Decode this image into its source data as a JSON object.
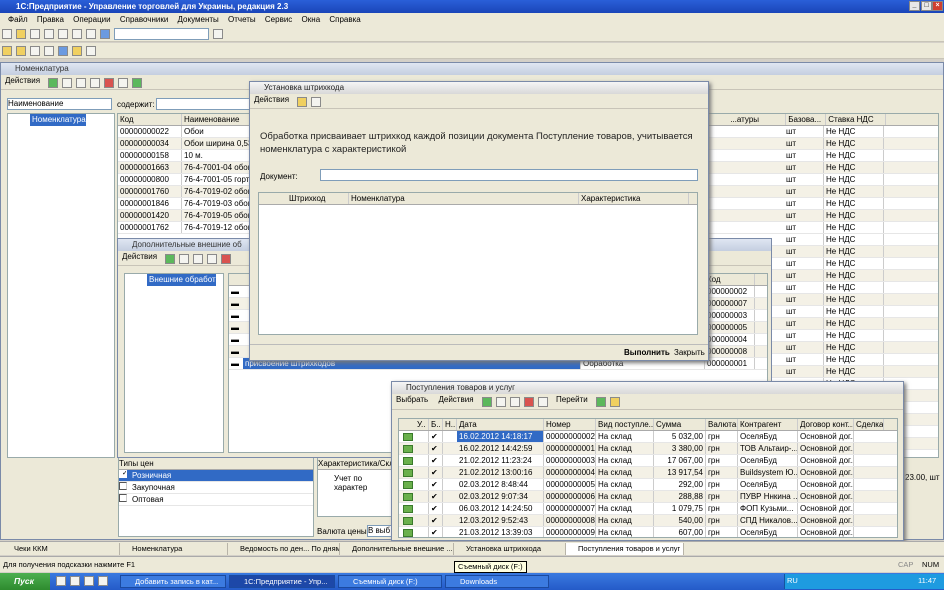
{
  "app": {
    "title": "1С:Предприятие - Управление торговлей для Украины, редакция 2.3"
  },
  "menu": [
    "Файл",
    "Правка",
    "Операции",
    "Справочники",
    "Документы",
    "Отчеты",
    "Сервис",
    "Окна",
    "Справка"
  ],
  "nomenclature": {
    "title": "Номенклатура",
    "actions": "Действия",
    "filter_field": "Наименование",
    "contains_label": "содержит:",
    "tree_root": "Номенклатура",
    "columns": [
      "Код",
      "Наименование"
    ],
    "right_columns": [
      "...атуры",
      "Базова...",
      "Ставка НДС"
    ],
    "rows": [
      [
        "00000000022",
        "Обои"
      ],
      [
        "00000000034",
        "Обои ширина 0,53 м"
      ],
      [
        "00000000158",
        "10 м."
      ],
      [
        "00000001663",
        "76-4-7001-04 обои о"
      ],
      [
        "00000000800",
        "76-4-7001-05 гортен"
      ],
      [
        "00000001760",
        "76-4-7019-02 обои а"
      ],
      [
        "00000001846",
        "76-4-7019-03 обои 5"
      ],
      [
        "00000001420",
        "76-4-7019-05 обои а"
      ],
      [
        "00000001762",
        "76-4-7019-12 обои а"
      ]
    ],
    "unit": "шт",
    "vat": "Не НДС",
    "price_types_header": "Типы цен",
    "price_types": [
      "Розничная",
      "Закупочная",
      "Оптовая"
    ],
    "char_header": "Характеристика/Скл",
    "char_value": "Учет по характер",
    "currency_label": "Валюта цены:",
    "currency_value": "В выб",
    "right_price": "23.00, шт"
  },
  "external": {
    "title": "Дополнительные внешние об",
    "actions": "Действия",
    "tree_root": "Внешние обработ",
    "code_header": "Код",
    "codes": [
      "000000002",
      "000000007",
      "000000003",
      "000000005",
      "000000004",
      "000000008",
      "000000001"
    ],
    "bottom_name": "присвоение штрихкодов",
    "bottom_type": "Обработка"
  },
  "barcode": {
    "title": "Установка штрихкода",
    "actions": "Действия",
    "message": "Обработка присваивает штрихкод каждой позиции документа  Поступление товаров, учитывается номенклатура с характеристикой",
    "doc_label": "Документ:",
    "columns": [
      "Штрихкод",
      "Номенклатура",
      "Характеристика"
    ],
    "run_button": "Выполнить",
    "close_button": "Закрыть"
  },
  "receipts": {
    "title": "Поступления товаров и услуг",
    "select_button": "Выбрать",
    "actions": "Действия",
    "goto": "Перейти",
    "columns": [
      "У..",
      "Б..",
      "Н..",
      "Дата",
      "Номер",
      "Вид поступле...",
      "Сумма",
      "Валюта",
      "Контрагент",
      "Договор конт...",
      "Сделка"
    ],
    "rows": [
      [
        "16.02.2012 14:18:17",
        "00000000002",
        "На склад",
        "5 032,00",
        "грн",
        "ОселяБуд",
        "Основной дог..."
      ],
      [
        "16.02.2012 14:42:59",
        "00000000001",
        "На склад",
        "3 380,00",
        "грн",
        "ТОВ Альтаир-...",
        "Основной дог..."
      ],
      [
        "21.02.2012 11:23:24",
        "00000000003",
        "На склад",
        "17 067,00",
        "грн",
        "ОселяБуд",
        "Основной дог..."
      ],
      [
        "21.02.2012 13:00:16",
        "00000000004",
        "На склад",
        "13 917,54",
        "грн",
        "Buildsystem Ю...",
        "Основной дог..."
      ],
      [
        "02.03.2012 8:48:44",
        "00000000005",
        "На склад",
        "292,00",
        "грн",
        "ОселяБуд",
        "Основной дог..."
      ],
      [
        "02.03.2012 9:07:34",
        "00000000006",
        "На склад",
        "288,88",
        "грн",
        "ПУВР Ннкина ...",
        "Основной дог..."
      ],
      [
        "06.03.2012 14:24:50",
        "00000000007",
        "На склад",
        "1 079,75",
        "грн",
        "ФОП Кузьми...",
        "Основной дог..."
      ],
      [
        "12.03.2012 9:52:43",
        "00000000008",
        "На склад",
        "540,00",
        "грн",
        "СПД Никалов...",
        "Основной дог..."
      ],
      [
        "21.03.2012 13:39:03",
        "00000000009",
        "На склад",
        "607,00",
        "грн",
        "ОселяБуд",
        "Основной дог..."
      ]
    ]
  },
  "windows_bar": [
    "Чеки ККМ",
    "Номенклатура",
    "Ведомость по ден... По дням",
    "Дополнительные внешние ...",
    "Установка штрихкода",
    "Поступления товаров и услуг"
  ],
  "status": {
    "hint": "Для получения подсказки нажмите F1",
    "tooltip": "Съемный диск (F:)",
    "cap": "CAP",
    "num": "NUM"
  },
  "taskbar": {
    "start": "Пуск",
    "items": [
      "Добавить запись в кат...",
      "1С:Предприятие - Упр...",
      "Съемный диск (F:)",
      "Downloads"
    ],
    "lang": "RU",
    "clock": "11:47"
  }
}
